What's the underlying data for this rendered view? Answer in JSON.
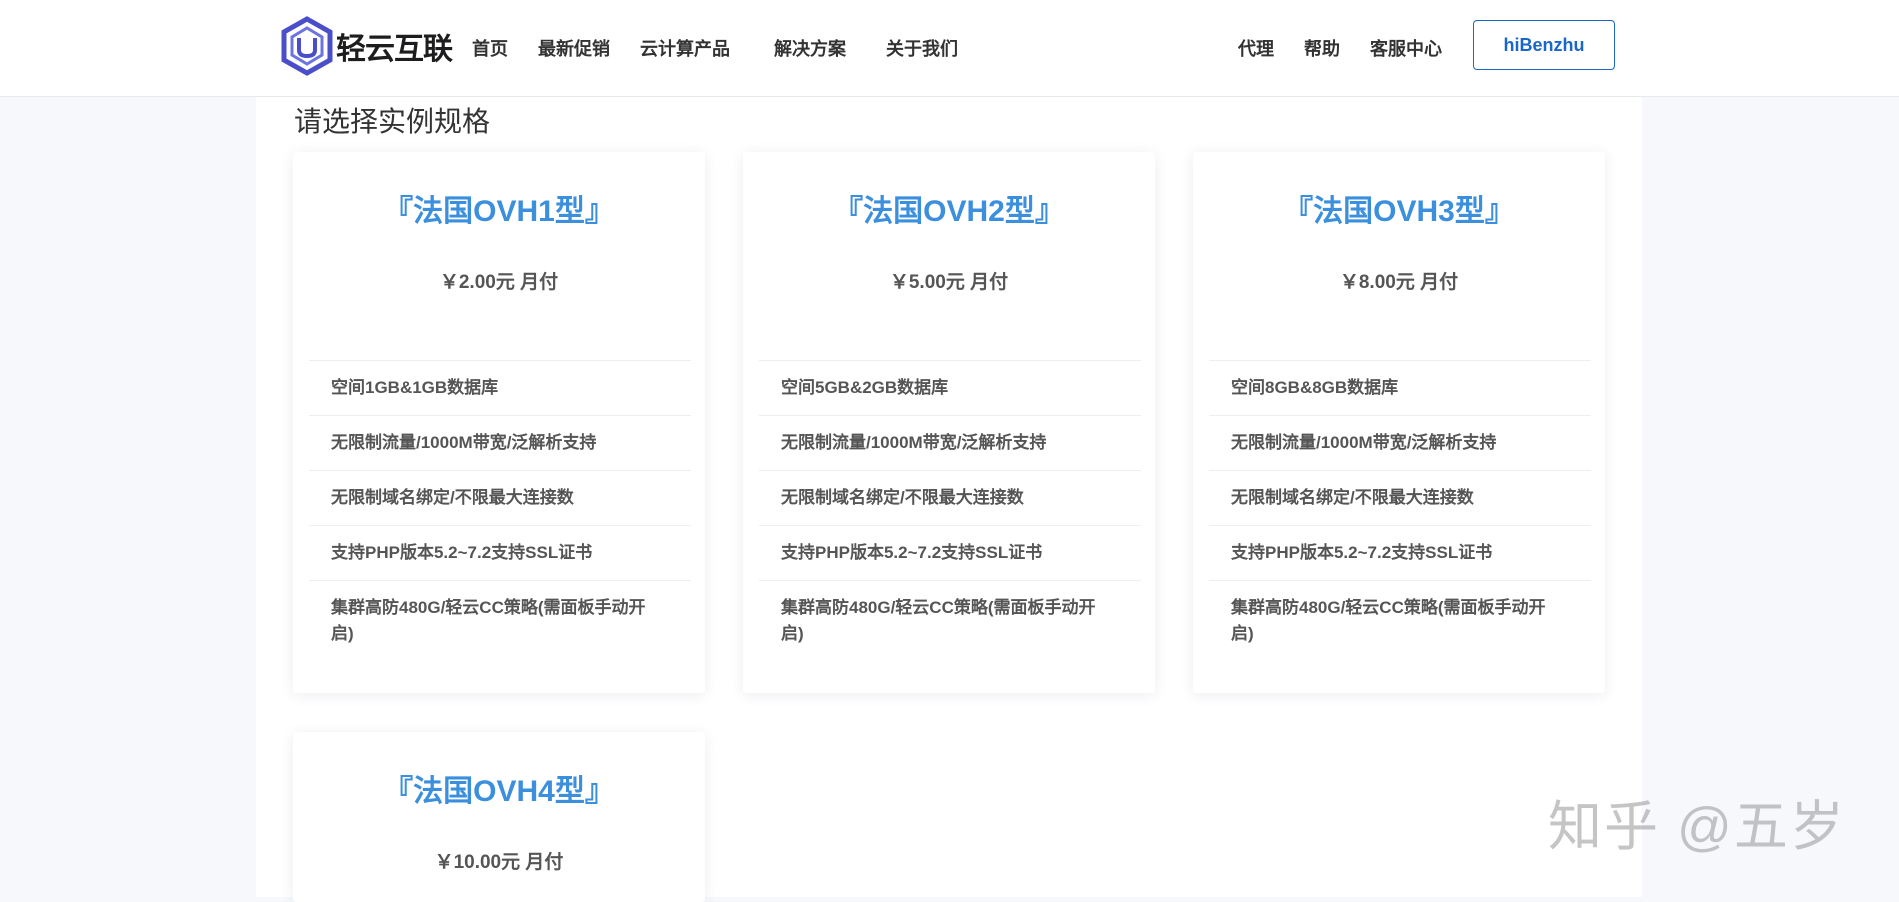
{
  "brand": {
    "name": "轻云互联"
  },
  "nav": {
    "left": [
      "首页",
      "最新促销",
      "云计算产品",
      "解决方案",
      "关于我们"
    ],
    "right": [
      "代理",
      "帮助",
      "客服中心"
    ],
    "user_button": "hiBenzhu"
  },
  "section_title": "请选择实例规格",
  "plans": [
    {
      "title": "『法国OVH1型』",
      "price": "￥2.00元 月付",
      "features": [
        "空间1GB&1GB数据库",
        "无限制流量/1000M带宽/泛解析支持",
        "无限制域名绑定/不限最大连接数",
        "支持PHP版本5.2~7.2支持SSL证书",
        "集群高防480G/轻云CC策略(需面板手动开启)"
      ]
    },
    {
      "title": "『法国OVH2型』",
      "price": "￥5.00元 月付",
      "features": [
        "空间5GB&2GB数据库",
        "无限制流量/1000M带宽/泛解析支持",
        "无限制域名绑定/不限最大连接数",
        "支持PHP版本5.2~7.2支持SSL证书",
        "集群高防480G/轻云CC策略(需面板手动开启)"
      ]
    },
    {
      "title": "『法国OVH3型』",
      "price": "￥8.00元 月付",
      "features": [
        "空间8GB&8GB数据库",
        "无限制流量/1000M带宽/泛解析支持",
        "无限制域名绑定/不限最大连接数",
        "支持PHP版本5.2~7.2支持SSL证书",
        "集群高防480G/轻云CC策略(需面板手动开启)"
      ]
    },
    {
      "title": "『法国OVH4型』",
      "price": "￥10.00元 月付",
      "features": []
    }
  ],
  "watermark": "知乎 @五岁",
  "colors": {
    "accent": "#3b8fdd",
    "button_border": "#1b66c9",
    "logo": "#4a4fc9"
  }
}
